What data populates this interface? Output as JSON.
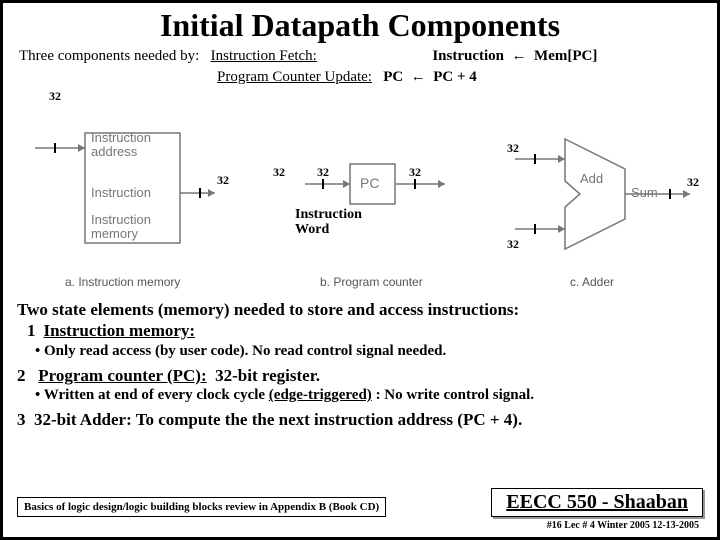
{
  "title": "Initial Datapath Components",
  "intro": {
    "prefix": "Three components needed by:",
    "row1_left": "Instruction Fetch:",
    "row1_right_a": "Instruction",
    "row1_right_b": "Mem[PC]",
    "row2_left": "Program Counter Update:",
    "row2_right_a": "PC",
    "row2_right_b": "PC + 4"
  },
  "diagram": {
    "bw32": "32",
    "labels": {
      "instr_addr": "Instruction\naddress",
      "instruction": "Instruction",
      "instr_mem": "Instruction\nmemory",
      "pc": "PC",
      "add": "Add",
      "sum": "Sum",
      "instr_word": "Instruction\nWord"
    },
    "captions": {
      "a": "a. Instruction memory",
      "b": "b. Program counter",
      "c": "c. Adder"
    }
  },
  "body": {
    "lead": "Two state elements (memory) needed to store and access instructions:",
    "one_label": "1",
    "one_text": "Instruction memory:",
    "one_bullet": "• Only read access  (by user code).   No read control signal needed.",
    "two_label": "2",
    "two_text_a": "Program counter (PC):",
    "two_text_b": "32-bit register.",
    "two_bullet_a": "• Written at end of every clock cycle",
    "two_bullet_edge": "(edge-triggered)",
    "two_bullet_b": ":  No write control signal.",
    "three_label": "3",
    "three_text": "32-bit Adder: To compute the the next instruction address (PC + 4)."
  },
  "footer": {
    "appendix": "Basics of logic design/logic building blocks review in Appendix B (Book CD)",
    "course": "EECC 550 - Shaaban",
    "meta": "#16   Lec # 4   Winter 2005   12-13-2005"
  }
}
